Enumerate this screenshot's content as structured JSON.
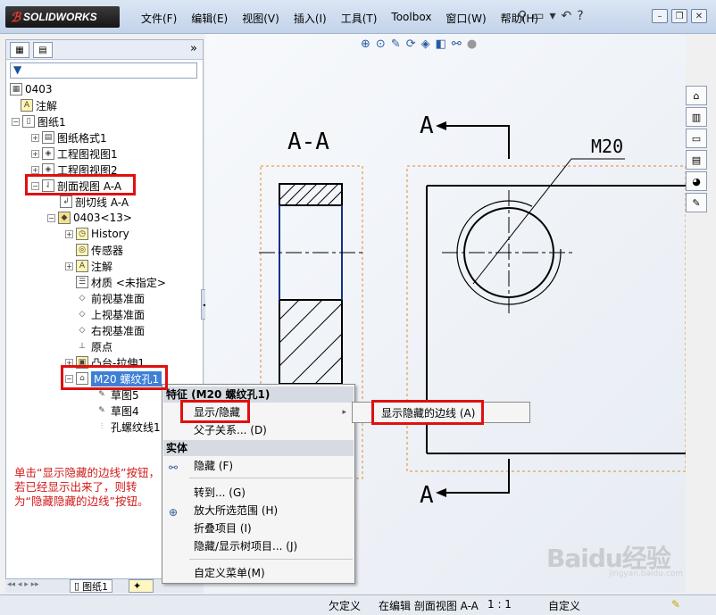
{
  "app": {
    "logo_text": "SOLIDWORKS"
  },
  "menu": [
    "文件(F)",
    "编辑(E)",
    "视图(V)",
    "插入(I)",
    "工具(T)",
    "Toolbox",
    "窗口(W)",
    "帮助(H)"
  ],
  "panel": {
    "collapse_label": "»"
  },
  "tree": {
    "root": "0403",
    "annotations": "注解",
    "sheet": "图纸1",
    "sheet_format": "图纸格式1",
    "view1": "工程图视图1",
    "view2": "工程图视图2",
    "section_view": "剖面视图 A-A",
    "cut_line": "剖切线 A-A",
    "part": "0403<13>",
    "history": "History",
    "sensors": "传感器",
    "part_annotations": "注解",
    "material": "材质 <未指定>",
    "front_plane": "前视基准面",
    "top_plane": "上视基准面",
    "right_plane": "右视基准面",
    "origin": "原点",
    "boss_extrude": "凸台-拉伸1",
    "hole_feature": "M20 螺纹孔1",
    "sketch5": "草图5",
    "sketch4": "草图4",
    "thread_line": "孔螺纹线1"
  },
  "bottom_tabs": [
    "图纸1"
  ],
  "drawing": {
    "section_label": "A-A",
    "cut_label_top": "A",
    "cut_label_bottom": "A",
    "thread_callout": "M20"
  },
  "context_menu": {
    "header_feature": "特征 (M20 螺纹孔1)",
    "show_hide": "显示/隐藏",
    "parent_child": "父子关系... (D)",
    "header_body": "实体",
    "hide": "隐藏 (F)",
    "goto": "转到... (G)",
    "zoom_selection": "放大所选范围 (H)",
    "collapse_items": "折叠项目 (I)",
    "hide_show_tree": "隐藏/显示树项目... (J)",
    "customize_menu": "自定义菜单(M)"
  },
  "submenu": {
    "show_hidden_edges": "显示隐藏的边线 (A)"
  },
  "note": "单击“显示隐藏的边线”按钮，若已经显示出来了，则转为“隐藏隐藏的边线”按钮。",
  "status": {
    "underdefined": "欠定义",
    "editing": "在编辑 剖面视图 A-A",
    "scale": "1 : 1",
    "custom": "自定义"
  },
  "watermark": "Baidu经验",
  "watermark_url": "jingyan.baidu.com",
  "colors": {
    "annotation_red": "#e01010",
    "selection_blue": "#3f80d6",
    "view_boundary_orange": "#e08a2a"
  }
}
